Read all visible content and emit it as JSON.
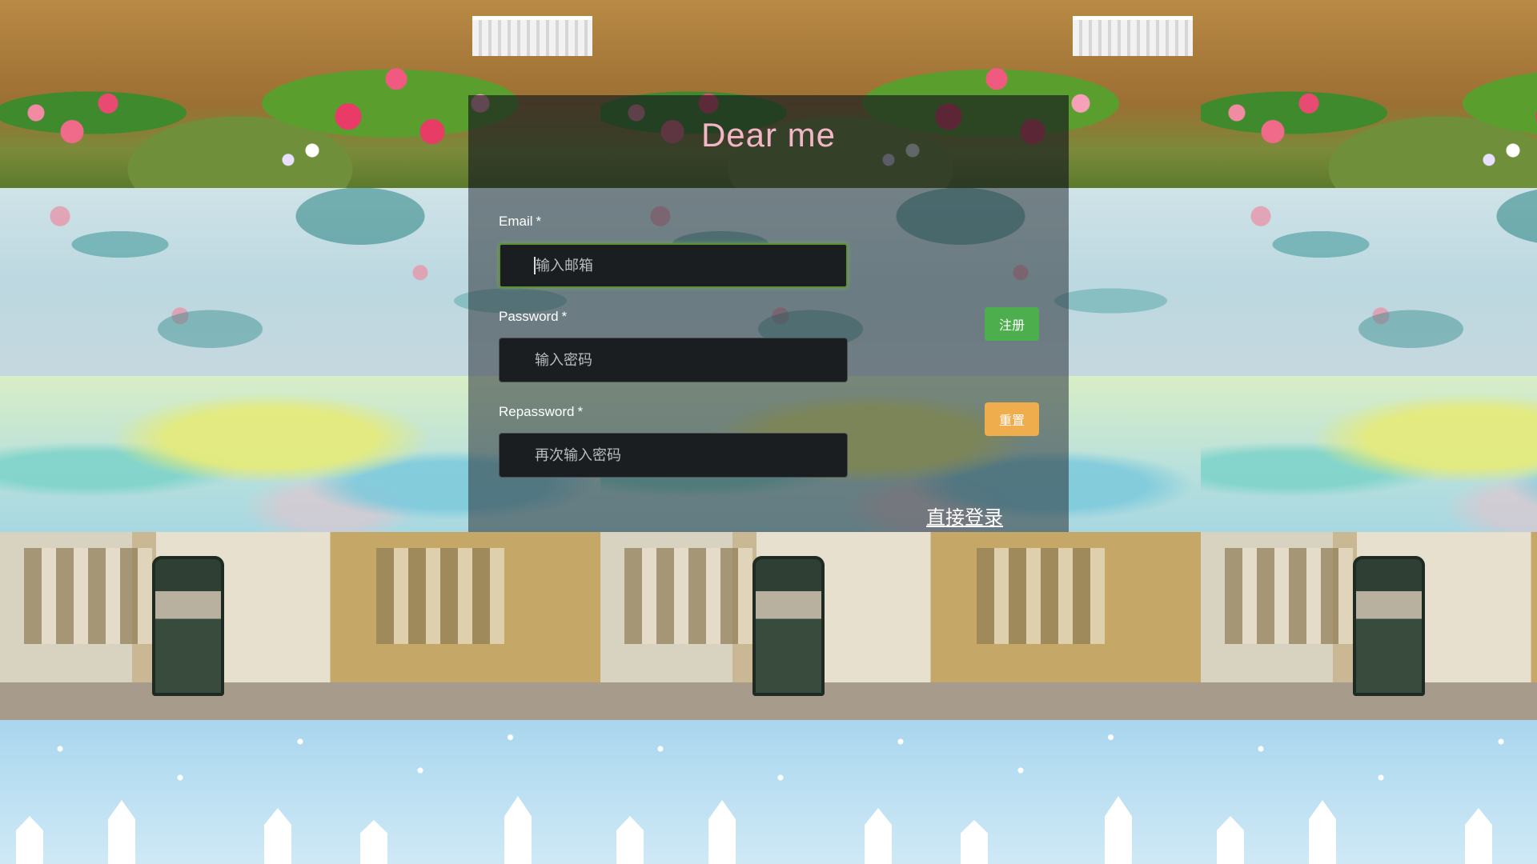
{
  "app": {
    "title": "Dear me"
  },
  "form": {
    "email": {
      "label": "Email",
      "required_mark": "*",
      "placeholder": "输入邮箱",
      "value": ""
    },
    "password": {
      "label": "Password",
      "required_mark": "*",
      "placeholder": "输入密码",
      "value": ""
    },
    "repassword": {
      "label": "Repassword",
      "required_mark": "*",
      "placeholder": "再次输入密码",
      "value": ""
    }
  },
  "actions": {
    "register_label": "注册",
    "reset_label": "重置",
    "login_link_label": "直接登录"
  },
  "colors": {
    "title": "#f3b6c6",
    "register_button": "#4cae4c",
    "reset_button": "#efad4d",
    "panel_overlay": "rgba(40,50,55,0.55)"
  }
}
